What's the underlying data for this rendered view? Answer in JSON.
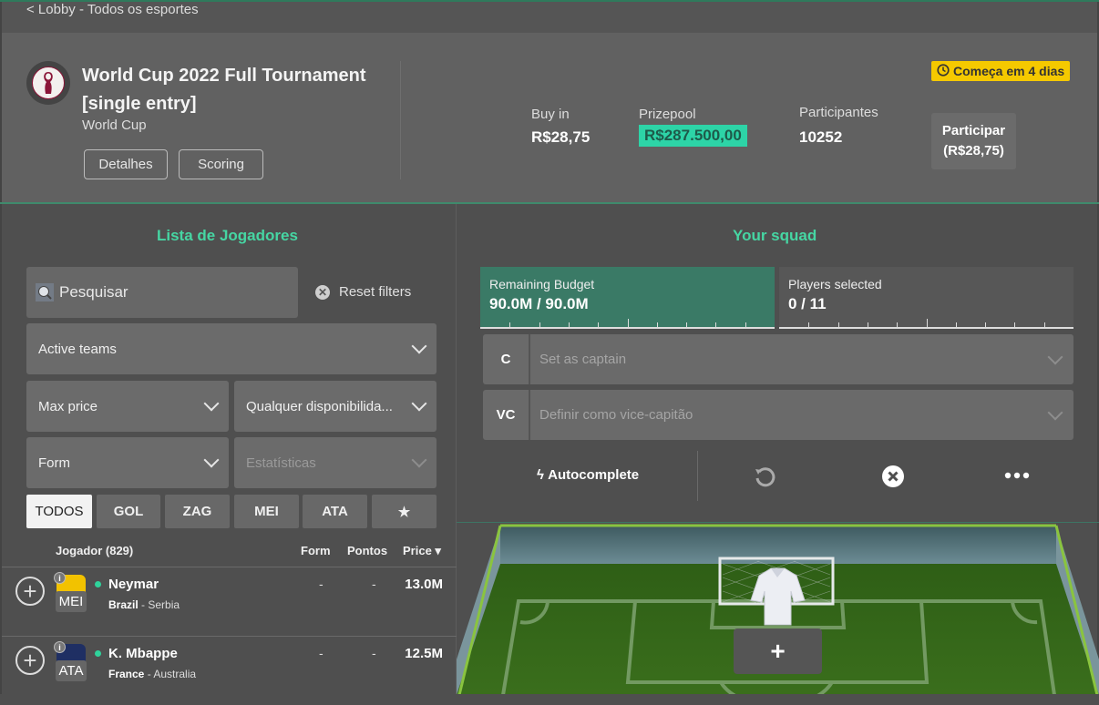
{
  "nav": {
    "back_label": "< Lobby - Todos os esportes"
  },
  "contest": {
    "title": "World Cup 2022 Full Tournament [single entry]",
    "league": "World Cup",
    "details_button": "Detalhes",
    "scoring_button": "Scoring",
    "starts_badge": "Começa em 4 dias",
    "buy_in_label": "Buy in",
    "buy_in_value": "R$28,75",
    "prizepool_label": "Prizepool",
    "prizepool_value": "R$287.500,00",
    "participants_label": "Participantes",
    "participants_value": "10252",
    "join_button_line1": "Participar",
    "join_button_line2": "(R$28,75)",
    "accent_color": "#2dd4a7",
    "badge_color": "#f5c900"
  },
  "players_panel": {
    "title": "Lista de Jogadores",
    "search_placeholder": "Pesquisar",
    "reset_filters": "Reset filters",
    "filters": {
      "teams": "Active teams",
      "max_price": "Max price",
      "availability": "Qualquer disponibilida...",
      "form": "Form",
      "stats": "Estatísticas"
    },
    "position_tabs": [
      {
        "label": "TODOS",
        "active": true
      },
      {
        "label": "GOL",
        "active": false
      },
      {
        "label": "ZAG",
        "active": false
      },
      {
        "label": "MEI",
        "active": false
      },
      {
        "label": "ATA",
        "active": false
      },
      {
        "label": "★",
        "active": false
      }
    ],
    "columns": {
      "player": "Jogador (829)",
      "form": "Form",
      "points": "Pontos",
      "price": "Price ▾"
    },
    "rows": [
      {
        "name": "Neymar",
        "team": "Brazil",
        "opponent": "Serbia",
        "position": "MEI",
        "form": "-",
        "points": "-",
        "price": "13.0M",
        "shirt_color": "#f2c200"
      },
      {
        "name": "K. Mbappe",
        "team": "France",
        "opponent": "Australia",
        "position": "ATA",
        "form": "-",
        "points": "-",
        "price": "12.5M",
        "shirt_color": "#1f2f63"
      }
    ]
  },
  "squad_panel": {
    "title": "Your squad",
    "budget_label": "Remaining Budget",
    "budget_value": "90.0M / 90.0M",
    "budget_remaining_fraction": 1.0,
    "players_label": "Players selected",
    "players_value": "0 / 11",
    "players_selected_fraction": 0.0,
    "captain_tag": "C",
    "captain_placeholder": "Set as captain",
    "vice_tag": "VC",
    "vice_placeholder": "Definir como vice-capitão",
    "autocomplete": "Autocomplete",
    "add_symbol": "+"
  }
}
